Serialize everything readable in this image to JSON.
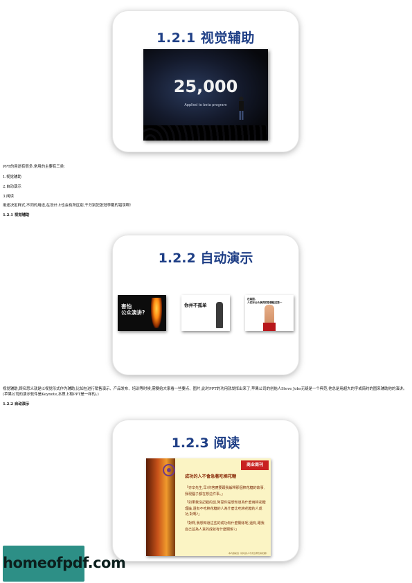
{
  "slides": {
    "visual": {
      "title": "1.2.1  视觉辅助",
      "big_number": "25,000",
      "caption": "Applied to beta program"
    },
    "auto": {
      "title": "1.2.2  自动演示",
      "thumb1": "害怕\n公众演讲?",
      "thumb2": "你并不孤单",
      "thumb3": "在美国,\n人们对公众演讲的恐惧超过第一"
    },
    "read": {
      "title": "1.2.3  阅读",
      "tag": "商业周刊",
      "doc_title": "成功的人不會急著吃棉花糖",
      "lines": [
        "「亦辛先生,早!你答應要跟我解釋那個棉花糖的故事,我現腦子都在想這件事。」",
        "「如果我沒記錯的話,阿惡你是想知道為什麼用棉花糖理論,還有不吃棉花糖的人為什麼比吃棉花糖的人成功,對嗎?」",
        "「對啊,我想知道這些的成功有什麼關係呢,還有,跟我自己並為人意的成就有什麼關係?」"
      ],
      "footer": "本內容來自《成功的人不會急著吃棉花糖》"
    }
  },
  "text": {
    "intro": "PPT的用途有很多,常用的主要有三类:",
    "item1": "1.视觉辅助",
    "item2": "2.自动演示",
    "item3": "3.阅读",
    "purpose": "用途决定样式,不同的用途,在设计上也会有所区别,千万别犯张冠李戴的错误啊!",
    "heading1": "1.2.1 视觉辅助",
    "para_visual": "视觉辅助,顾名思义就是以视觉形式作为辅助,比如在进行销售演示、产品发布、培训等时候,需要给大家看一些要点、图片,此时PPT的功用就发挥出来了,苹果公司的创始人Steve Jobs无疑是一个典范,他总是用超大的字或简约的图来辅助他的演讲。(苹果公司的演示软件是Keynote,本质上和PPT是一样的。)",
    "heading2": "1.2.2 自动演示"
  },
  "logo": {
    "text": "homeofpdf.com"
  }
}
